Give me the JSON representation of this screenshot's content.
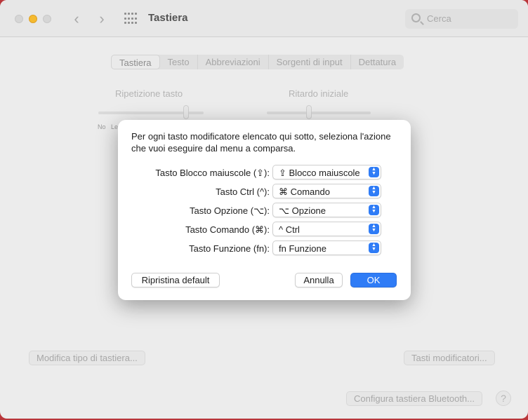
{
  "window": {
    "title": "Tastiera",
    "search_placeholder": "Cerca"
  },
  "tabs": [
    "Tastiera",
    "Testo",
    "Abbreviazioni",
    "Sorgenti di input",
    "Dettatura"
  ],
  "background": {
    "repeat_label": "Ripetizione tasto",
    "delay_label": "Ritardo iniziale",
    "repeat_min": "No",
    "repeat_slow": "Le",
    "modify_keyboard_button": "Modifica tipo di tastiera...",
    "modifier_keys_button": "Tasti modificatori...",
    "bluetooth_button": "Configura tastiera Bluetooth...",
    "help": "?"
  },
  "dialog": {
    "message": "Per ogni tasto modificatore elencato qui sotto, seleziona l'azione che vuoi eseguire dal menu a comparsa.",
    "rows": [
      {
        "label": "Tasto Blocco maiuscole (⇪):",
        "value": "⇪ Blocco maiuscole"
      },
      {
        "label": "Tasto Ctrl (^):",
        "value": "⌘ Comando"
      },
      {
        "label": "Tasto Opzione (⌥):",
        "value": "⌥ Opzione"
      },
      {
        "label": "Tasto Comando (⌘):",
        "value": "^ Ctrl"
      },
      {
        "label": "Tasto Funzione (fn):",
        "value": "fn Funzione"
      }
    ],
    "restore_button": "Ripristina default",
    "cancel_button": "Annulla",
    "ok_button": "OK"
  },
  "colors": {
    "accent": "#2f7cf6",
    "minimize_light": "#f5ba2f",
    "desktop": "#b9363a"
  }
}
